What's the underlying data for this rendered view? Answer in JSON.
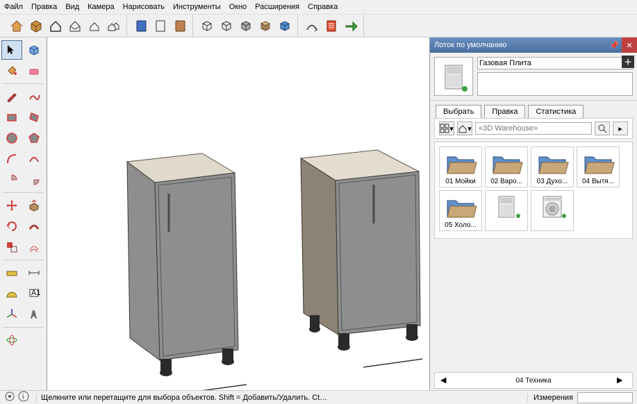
{
  "menu": [
    "Файл",
    "Правка",
    "Вид",
    "Камера",
    "Нарисовать",
    "Инструменты",
    "Окно",
    "Расширения",
    "Справка"
  ],
  "tray": {
    "title": "Лоток по умолчанию",
    "component_name": "Газовая Плита",
    "component_desc": "",
    "tabs": [
      "Выбрать",
      "Правка",
      "Статистика"
    ],
    "search_placeholder": "«3D Warehouse»",
    "folders": [
      {
        "label": "01 Мойки",
        "type": "folder"
      },
      {
        "label": "02 Варо...",
        "type": "folder"
      },
      {
        "label": "03 Духо...",
        "type": "folder"
      },
      {
        "label": "04 Вытя...",
        "type": "folder"
      },
      {
        "label": "05 Холо...",
        "type": "folder"
      },
      {
        "label": "",
        "type": "stove"
      },
      {
        "label": "",
        "type": "washer"
      }
    ],
    "nav_current": "04 Техника"
  },
  "status": {
    "hint": "Щелкните или перетащите для выбора объектов. Shift = Добавить/Удалить. Ctrl = Д...",
    "measure_label": "Измерения"
  }
}
